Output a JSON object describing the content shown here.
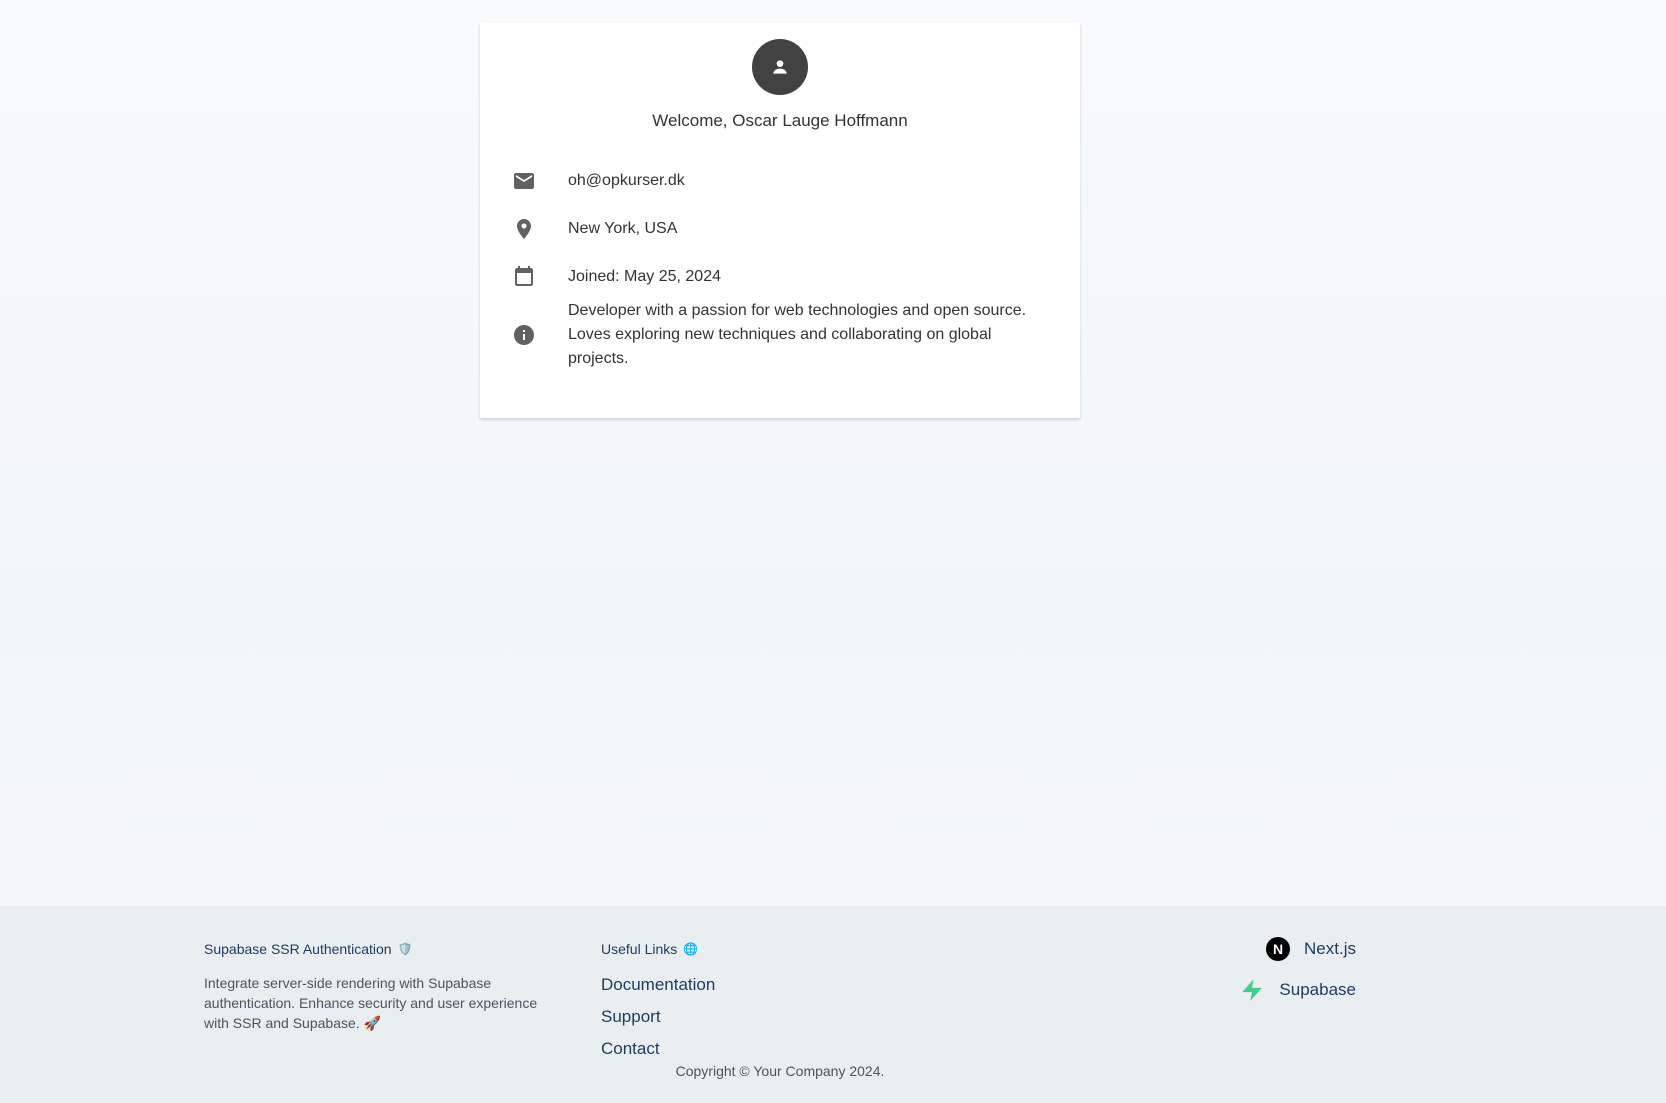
{
  "profile": {
    "welcome": "Welcome, Oscar Lauge Hoffmann",
    "email": "oh@opkurser.dk",
    "location": "New York, USA",
    "joined": "Joined: May 25, 2024",
    "bio": "Developer with a passion for web technologies and open source. Loves exploring new techniques and collaborating on global projects."
  },
  "footer": {
    "brand_title": "Supabase SSR Authentication",
    "brand_emoji": "🛡️",
    "description": "Integrate server-side rendering with Supabase authentication. Enhance security and user experience with SSR and Supabase. 🚀",
    "links_title": "Useful Links",
    "links_emoji": "🌐",
    "links": {
      "documentation": "Documentation",
      "support": "Support",
      "contact": "Contact"
    },
    "tech": {
      "nextjs": "Next.js",
      "nextjs_logo_letter": "N",
      "supabase": "Supabase"
    },
    "copyright": "Copyright © Your Company 2024."
  },
  "colors": {
    "avatar_bg": "#424242",
    "icon_gray": "#616161",
    "footer_bg": "#e9eef1",
    "link_color": "#1f3a5f",
    "supabase_green": "#3ecf8e"
  },
  "icons": {
    "avatar": "person-icon",
    "email": "mail-icon",
    "location": "map-pin-icon",
    "joined": "calendar-icon",
    "bio": "info-icon",
    "nextjs": "nextjs-logo-icon",
    "supabase": "supabase-logo-icon"
  }
}
